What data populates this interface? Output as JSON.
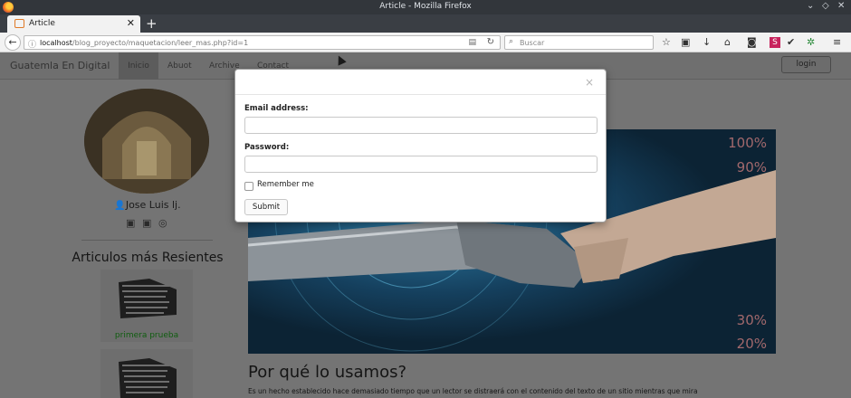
{
  "window": {
    "title": "Article - Mozilla Firefox"
  },
  "tab": {
    "label": "Article"
  },
  "address": {
    "host": "localhost",
    "path": "/blog_proyecto/maquetacion/leer_mas.php?id=1"
  },
  "search": {
    "placeholder": "Buscar"
  },
  "site": {
    "brand": "Guatemla En Digital",
    "nav": [
      "Inicio",
      "Abuot",
      "Archive",
      "Contact"
    ],
    "login": "login"
  },
  "sidebar": {
    "author": "Jose Luis lj.",
    "recent_title": "Articulos más Resientes",
    "recent": [
      {
        "label": "primera prueba"
      }
    ]
  },
  "article": {
    "title": "Por qué lo usamos?",
    "text": "Es un hecho establecido hace demasiado tiempo que un lector se distraerá con el contenido del texto de un sitio mientras que mira",
    "hero_overlay": [
      "100%",
      "90%",
      "30%",
      "20%"
    ]
  },
  "modal": {
    "close": "×",
    "email_label": "Email address:",
    "password_label": "Password:",
    "remember_label": "Remember me",
    "submit_label": "Submit"
  },
  "colors": {
    "link_green": "#0f5d0f",
    "user_icon": "#1f5a77",
    "overlay": "#747474"
  }
}
